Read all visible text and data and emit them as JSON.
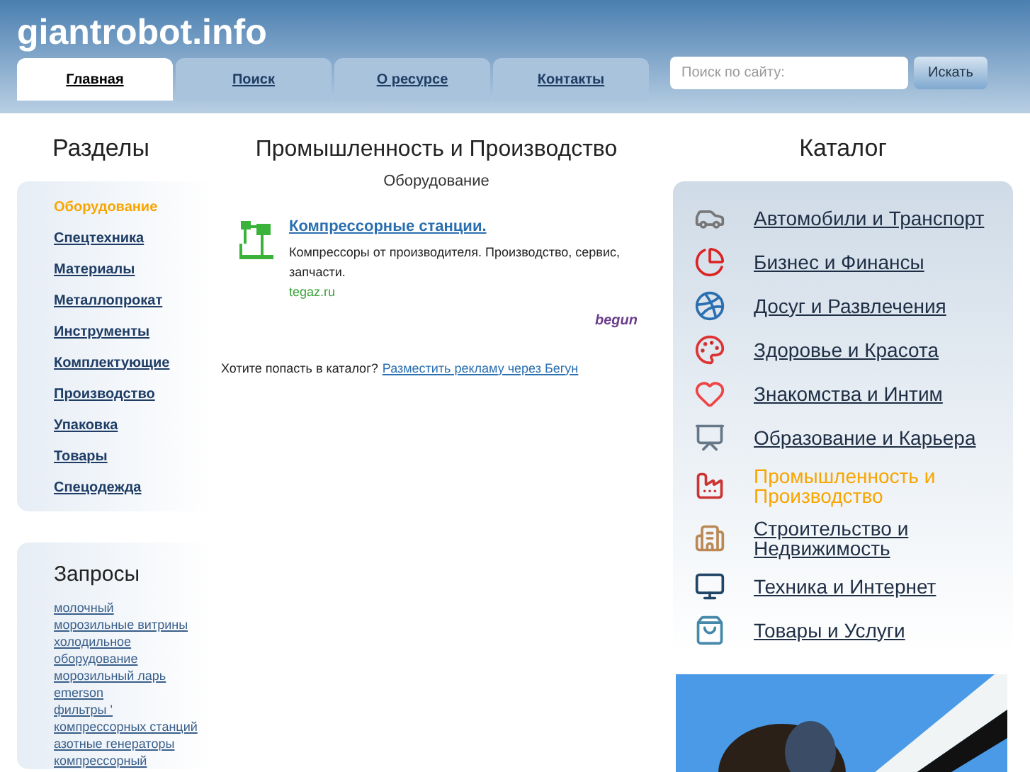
{
  "site_title": "giantrobot.info",
  "tabs": [
    {
      "label": "Главная",
      "selected": true
    },
    {
      "label": "Поиск",
      "selected": false
    },
    {
      "label": "О ресурсе",
      "selected": false
    },
    {
      "label": "Контакты",
      "selected": false
    }
  ],
  "search": {
    "placeholder": "Поиск по сайту:",
    "button": "Искать"
  },
  "sections": {
    "title": "Разделы",
    "items": [
      {
        "label": "Оборудование",
        "selected": true
      },
      {
        "label": "Спецтехника",
        "selected": false
      },
      {
        "label": "Материалы",
        "selected": false
      },
      {
        "label": "Металлопрокат",
        "selected": false
      },
      {
        "label": "Инструменты",
        "selected": false
      },
      {
        "label": "Комплектующие",
        "selected": false
      },
      {
        "label": "Производство",
        "selected": false
      },
      {
        "label": "Упаковка",
        "selected": false
      },
      {
        "label": "Товары",
        "selected": false
      },
      {
        "label": "Спецодежда",
        "selected": false
      }
    ]
  },
  "queries": {
    "title": "Запросы",
    "items": [
      "молочный",
      "морозильные витрины",
      "холодильное оборудование",
      "морозильный ларь",
      "emerson",
      "фильтры '",
      "компрессорных станций",
      "азотные генераторы",
      "компрессорный"
    ]
  },
  "main": {
    "title": "Промышленность и Производство",
    "subtitle": "Оборудование",
    "ad": {
      "title": "Компрессорные станции.",
      "text": "Компрессоры от производителя. Производство, сервис, запчасти.",
      "domain": "tegaz.ru",
      "brand": "begun"
    },
    "cta_text": "Хотите попасть в каталог?",
    "cta_link": "Разместить рекламу через Бегун"
  },
  "catalog": {
    "title": "Каталог",
    "items": [
      {
        "label": "Автомобили и Транспорт",
        "selected": false
      },
      {
        "label": "Бизнес и Финансы",
        "selected": false
      },
      {
        "label": "Досуг и Развлечения",
        "selected": false
      },
      {
        "label": "Здоровье и Красота",
        "selected": false
      },
      {
        "label": "Знакомства и Интим",
        "selected": false
      },
      {
        "label": "Образование и Карьера",
        "selected": false
      },
      {
        "label": "Промышленность и Производство",
        "selected": true
      },
      {
        "label": "Строительство и Недвижимость",
        "selected": false
      },
      {
        "label": "Техника и Интернет",
        "selected": false
      },
      {
        "label": "Товары и Услуги",
        "selected": false
      }
    ]
  }
}
